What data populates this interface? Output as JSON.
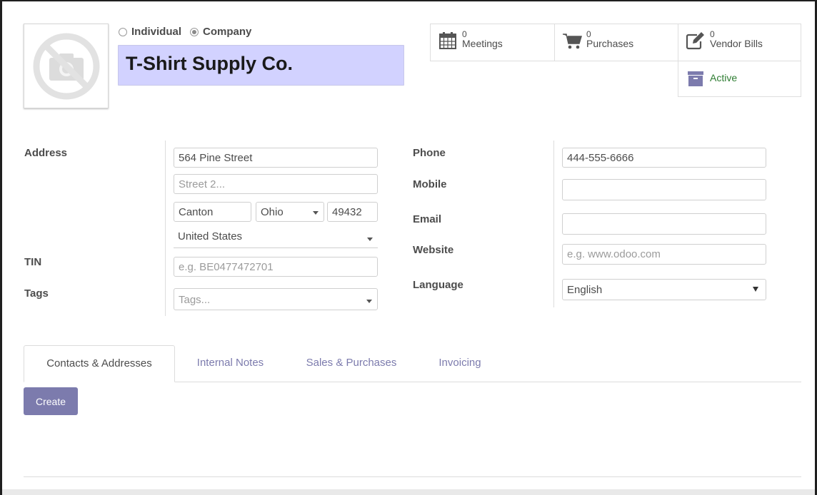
{
  "partner": {
    "type_options": [
      {
        "label": "Individual",
        "checked": false
      },
      {
        "label": "Company",
        "checked": true
      }
    ],
    "name": "T-Shirt Supply Co."
  },
  "smart_buttons": {
    "meetings": {
      "count": "0",
      "label": "Meetings",
      "icon": "calendar-icon"
    },
    "purchases": {
      "count": "0",
      "label": "Purchases",
      "icon": "shopping-cart-icon"
    },
    "vendor_bills": {
      "count": "0",
      "label": "Vendor Bills",
      "icon": "pencil-square-icon"
    },
    "active": {
      "label": "Active",
      "icon": "archive-icon",
      "color": "#2e7d32"
    }
  },
  "form": {
    "address_label": "Address",
    "street": "564 Pine Street",
    "street2_placeholder": "Street 2...",
    "city": "Canton",
    "state": "Ohio",
    "zip": "49432",
    "country": "United States",
    "tin_label": "TIN",
    "tin_placeholder": "e.g. BE0477472701",
    "tags_label": "Tags",
    "tags_placeholder": "Tags...",
    "phone_label": "Phone",
    "phone": "444-555-6666",
    "mobile_label": "Mobile",
    "mobile": "",
    "email_label": "Email",
    "email": "",
    "website_label": "Website",
    "website_placeholder": "e.g. www.odoo.com",
    "language_label": "Language",
    "language": "English"
  },
  "tabs": [
    {
      "label": "Contacts & Addresses",
      "active": true
    },
    {
      "label": "Internal Notes",
      "active": false
    },
    {
      "label": "Sales & Purchases",
      "active": false
    },
    {
      "label": "Invoicing",
      "active": false
    }
  ],
  "create_label": "Create",
  "colors": {
    "accent": "#7c7bad",
    "name_bg": "#d2d2ff",
    "active_green": "#2e7d32"
  }
}
